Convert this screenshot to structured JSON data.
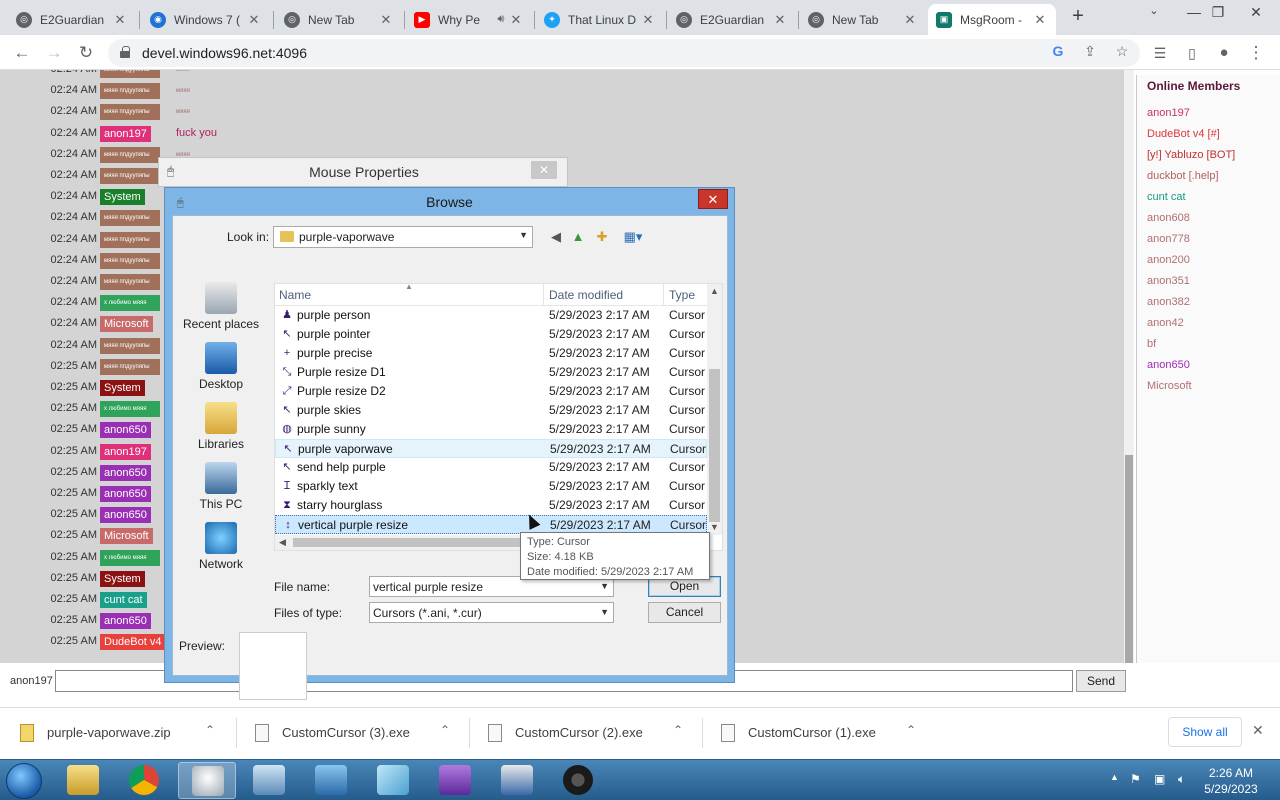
{
  "browser": {
    "tabs": [
      {
        "label": "E2Guardian",
        "fav": "globe-icon",
        "color": "#5f6368"
      },
      {
        "label": "Windows 7 (",
        "fav": "windows96-icon",
        "color": "#1e73d4"
      },
      {
        "label": "New Tab",
        "fav": "globe-icon",
        "color": "#5f6368"
      },
      {
        "label": "Why Pe",
        "fav": "youtube-icon",
        "color": "#ff0000"
      },
      {
        "label": "That Linux D",
        "fav": "twitter-icon",
        "color": "#1da1f2"
      },
      {
        "label": "E2Guardian",
        "fav": "globe-icon",
        "color": "#5f6368"
      },
      {
        "label": "New Tab",
        "fav": "globe-icon",
        "color": "#5f6368"
      },
      {
        "label": "MsgRoom -",
        "fav": "msgroom-icon",
        "color": "#0f7a6a"
      }
    ],
    "url": "devel.windows96.net:4096"
  },
  "chat": {
    "rows": [
      {
        "time": "02:24 AM",
        "user": "мяяя ппдуупяпы",
        "color": "#a0705a",
        "text": "мяяя",
        "tiny": true
      },
      {
        "time": "02:24 AM",
        "user": "мяяя ппдуупяпы",
        "color": "#a0705a",
        "text": "мяяя",
        "tiny": true
      },
      {
        "time": "02:24 AM",
        "user": "мяяя ппдуупяпы",
        "color": "#a0705a",
        "text": "мяяя",
        "tiny": true
      },
      {
        "time": "02:24 AM",
        "user": "anon197",
        "color": "#e0307a",
        "text": "fuck you",
        "tiny": false
      },
      {
        "time": "02:24 AM",
        "user": "мяяя ппдуупяпы",
        "color": "#a0705a",
        "text": "мяяя",
        "tiny": true
      },
      {
        "time": "02:24 AM",
        "user": "мяяя ппдуупяпы",
        "color": "#a0705a",
        "text": "",
        "tiny": true
      },
      {
        "time": "02:24 AM",
        "user": "System",
        "color": "#1a7f2a",
        "text": "",
        "tiny": false
      },
      {
        "time": "02:24 AM",
        "user": "мяяя ппдуупяпы",
        "color": "#a0705a",
        "text": "",
        "tiny": true
      },
      {
        "time": "02:24 AM",
        "user": "мяяя ппдуупяпы",
        "color": "#a0705a",
        "text": "",
        "tiny": true
      },
      {
        "time": "02:24 AM",
        "user": "мяяя ппдуупяпы",
        "color": "#a0705a",
        "text": "",
        "tiny": true
      },
      {
        "time": "02:24 AM",
        "user": "мяяя ппдуупяпы",
        "color": "#a0705a",
        "text": "",
        "tiny": true
      },
      {
        "time": "02:24 AM",
        "user": "x любимо мяяя",
        "color": "#2fa35a",
        "text": "",
        "tiny": true
      },
      {
        "time": "02:24 AM",
        "user": "Microsoft",
        "color": "#c86a6a",
        "text": "",
        "tiny": false
      },
      {
        "time": "02:24 AM",
        "user": "мяяя ппдуупяпы",
        "color": "#a0705a",
        "text": "",
        "tiny": true
      },
      {
        "time": "02:25 AM",
        "user": "мяяя ппдуупяпы",
        "color": "#a0705a",
        "text": "",
        "tiny": true
      },
      {
        "time": "02:25 AM",
        "user": "System",
        "color": "#8b1212",
        "text": "",
        "tiny": false
      },
      {
        "time": "02:25 AM",
        "user": "x любимо мяяя",
        "color": "#2fa35a",
        "text": "",
        "tiny": true
      },
      {
        "time": "02:25 AM",
        "user": "anon650",
        "color": "#9a2fb5",
        "text": "",
        "tiny": false
      },
      {
        "time": "02:25 AM",
        "user": "anon197",
        "color": "#e0307a",
        "text": "",
        "tiny": false
      },
      {
        "time": "02:25 AM",
        "user": "anon650",
        "color": "#9a2fb5",
        "text": "",
        "tiny": false
      },
      {
        "time": "02:25 AM",
        "user": "anon650",
        "color": "#9a2fb5",
        "text": "",
        "tiny": false
      },
      {
        "time": "02:25 AM",
        "user": "anon650",
        "color": "#9a2fb5",
        "text": "",
        "tiny": false
      },
      {
        "time": "02:25 AM",
        "user": "Microsoft",
        "color": "#c86a6a",
        "text": "",
        "tiny": false
      },
      {
        "time": "02:25 AM",
        "user": "x любимо мяяя",
        "color": "#2fa35a",
        "text": "",
        "tiny": true
      },
      {
        "time": "02:25 AM",
        "user": "System",
        "color": "#8b1212",
        "text": "",
        "tiny": false
      },
      {
        "time": "02:25 AM",
        "user": "cunt cat",
        "color": "#1aa08a",
        "text": "",
        "tiny": false
      },
      {
        "time": "02:25 AM",
        "user": "anon650",
        "color": "#9a2fb5",
        "text": "",
        "tiny": false
      },
      {
        "time": "02:25 AM",
        "user": "DudeBot v4 [#]",
        "color": "#e8403a",
        "text": "",
        "tiny": false
      }
    ],
    "input_user": "anon197",
    "send_label": "Send"
  },
  "members": {
    "title": "Online Members",
    "list": [
      {
        "name": "anon197",
        "color": "#c8306a"
      },
      {
        "name": "DudeBot v4 [#]",
        "color": "#d83a3a"
      },
      {
        "name": "[y!] Yabluzo [BOT]",
        "color": "#c03030"
      },
      {
        "name": "duckbot [.help]",
        "color": "#b06060"
      },
      {
        "name": "cunt cat",
        "color": "#1a9a80"
      },
      {
        "name": "anon608",
        "color": "#b07070"
      },
      {
        "name": "anon778",
        "color": "#b07070"
      },
      {
        "name": "anon200",
        "color": "#b07070"
      },
      {
        "name": "anon351",
        "color": "#b07070"
      },
      {
        "name": "anon382",
        "color": "#b07070"
      },
      {
        "name": "anon42",
        "color": "#b07070"
      },
      {
        "name": "bf",
        "color": "#b07070"
      },
      {
        "name": "anon650",
        "color": "#9a2fb5"
      },
      {
        "name": "Microsoft",
        "color": "#b07070"
      }
    ]
  },
  "mouse_props": {
    "title": "Mouse Properties"
  },
  "browse": {
    "title": "Browse",
    "look_in_label": "Look in:",
    "look_in_value": "purple-vaporwave",
    "places": [
      "Recent places",
      "Desktop",
      "Libraries",
      "This PC",
      "Network"
    ],
    "columns": {
      "name": "Name",
      "date": "Date modified",
      "type": "Type"
    },
    "files": [
      {
        "name": "purple person",
        "date": "5/29/2023 2:17 AM",
        "type": "Cursor",
        "state": ""
      },
      {
        "name": "purple pointer",
        "date": "5/29/2023 2:17 AM",
        "type": "Cursor",
        "state": ""
      },
      {
        "name": "purple precise",
        "date": "5/29/2023 2:17 AM",
        "type": "Cursor",
        "state": ""
      },
      {
        "name": "Purple resize D1",
        "date": "5/29/2023 2:17 AM",
        "type": "Cursor",
        "state": ""
      },
      {
        "name": "Purple resize D2",
        "date": "5/29/2023 2:17 AM",
        "type": "Cursor",
        "state": ""
      },
      {
        "name": "purple skies",
        "date": "5/29/2023 2:17 AM",
        "type": "Cursor",
        "state": ""
      },
      {
        "name": "purple sunny",
        "date": "5/29/2023 2:17 AM",
        "type": "Cursor",
        "state": ""
      },
      {
        "name": "purple vaporwave",
        "date": "5/29/2023 2:17 AM",
        "type": "Cursor",
        "state": "hover"
      },
      {
        "name": "send help purple",
        "date": "5/29/2023 2:17 AM",
        "type": "Cursor",
        "state": ""
      },
      {
        "name": "sparkly text",
        "date": "5/29/2023 2:17 AM",
        "type": "Cursor",
        "state": ""
      },
      {
        "name": "starry hourglass",
        "date": "5/29/2023 2:17 AM",
        "type": "Cursor",
        "state": ""
      },
      {
        "name": "vertical purple resize",
        "date": "5/29/2023 2:17 AM",
        "type": "Cursor",
        "state": "selected"
      }
    ],
    "tooltip": [
      "Type: Cursor",
      "Size: 4.18 KB",
      "Date modified: 5/29/2023 2:17 AM"
    ],
    "file_name_label": "File name:",
    "file_name_value": "vertical purple resize",
    "files_of_type_label": "Files of type:",
    "files_of_type_value": "Cursors (*.ani, *.cur)",
    "open_label": "Open",
    "cancel_label": "Cancel",
    "preview_label": "Preview:"
  },
  "downloads": {
    "items": [
      "purple-vaporwave.zip",
      "CustomCursor (3).exe",
      "CustomCursor (2).exe",
      "CustomCursor (1).exe"
    ],
    "show_all": "Show all"
  },
  "taskbar": {
    "apps": [
      "explorer",
      "chrome",
      "mouse-properties",
      "task-manager",
      "control-panel",
      "notepad",
      "visual-studio",
      "remote-desktop",
      "obs"
    ],
    "time": "2:26 AM",
    "date": "5/29/2023"
  }
}
